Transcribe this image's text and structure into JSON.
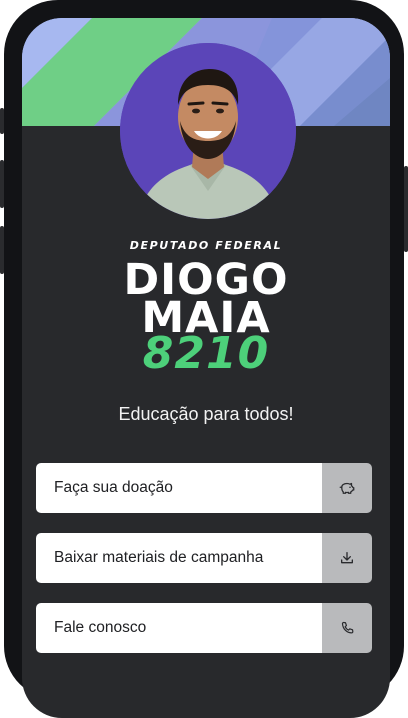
{
  "profile": {
    "role": "DEPUTADO FEDERAL",
    "name_line_1": "DIOGO",
    "name_line_2": "MAIA",
    "number": "8210",
    "tagline": "Educação para todos!"
  },
  "links": [
    {
      "label": "Faça sua doação",
      "icon": "piggy-bank-icon"
    },
    {
      "label": "Baixar materiais de campanha",
      "icon": "download-icon"
    },
    {
      "label": "Fale conosco",
      "icon": "phone-icon"
    }
  ],
  "colors": {
    "screen_bg": "#28292c",
    "frame": "#121316",
    "number_green": "#4dd07a",
    "avatar_bg": "#5b45b8",
    "icon_box": "#b9babc"
  }
}
